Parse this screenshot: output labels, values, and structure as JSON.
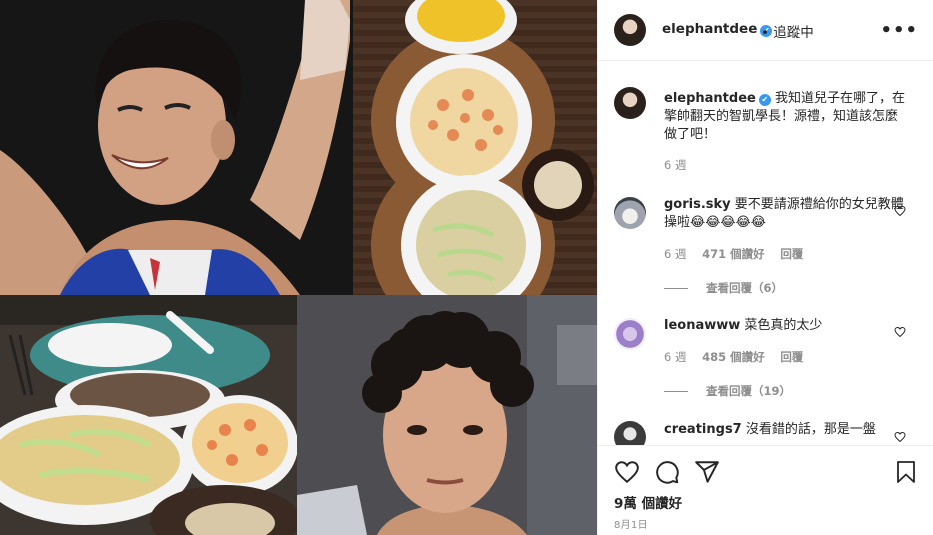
{
  "post": {
    "username": "elephantdee",
    "verified_symbol": "✔",
    "separator": "•",
    "follow_status": "追蹤中",
    "more_symbol": "•••"
  },
  "caption": {
    "username": "elephantdee",
    "text": "我知道兒子在哪了，在擎帥翻天的智凱學長！源禮，知道該怎麼做了吧！",
    "time": "6 週"
  },
  "comments": [
    {
      "username": "goris.sky",
      "text": "要不要請源禮給你的女兒教體操啦😂😂😂😂😂",
      "time": "6 週",
      "likes": "471 個讚好",
      "reply": "回覆",
      "view_replies": "查看回覆（6）"
    },
    {
      "username": "leonawww",
      "text": "菜色真的太少",
      "time": "6 週",
      "likes": "485 個讚好",
      "reply": "回覆",
      "view_replies": "查看回覆（19）"
    },
    {
      "username": "creatings7",
      "text": "沒看錯的話，那是一盤"
    }
  ],
  "footer": {
    "likes": "9萬 個讚好",
    "date": "8月1日"
  },
  "colors": {
    "verified": "#3897f0",
    "meta": "#8e8e8e",
    "text": "#262626",
    "border": "#efefef"
  },
  "icons": [
    "heart-icon",
    "comment-icon",
    "share-icon",
    "bookmark-icon",
    "more-options-icon",
    "verified-icon"
  ]
}
